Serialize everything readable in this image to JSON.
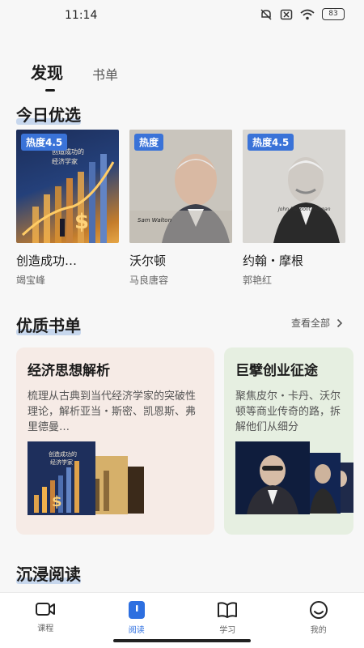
{
  "status": {
    "time": "11:14",
    "battery": "83"
  },
  "tabs": [
    {
      "label": "发现",
      "active": true
    },
    {
      "label": "书单",
      "active": false
    }
  ],
  "daily": {
    "title": "今日优选",
    "books": [
      {
        "badge": "热度4.5",
        "title": "创造成功…",
        "author": "竭宝峰"
      },
      {
        "badge": "热度",
        "title": "沃尔顿",
        "author": "马良唐容"
      },
      {
        "badge": "热度4.5",
        "title": "约翰・摩根",
        "author": "郭艳红"
      }
    ]
  },
  "quality": {
    "title": "优质书单",
    "see_all": "查看全部",
    "lists": [
      {
        "name": "经济思想解析",
        "desc": "梳理从古典到当代经济学家的突破性理论，解析亚当・斯密、凯恩斯、弗里德曼…"
      },
      {
        "name": "巨擘创业征途",
        "desc": "聚焦皮尔・卡丹、沃尔顿等商业传奇的路，拆解他们从细分"
      }
    ]
  },
  "immersive": {
    "title": "沉浸阅读"
  },
  "nav": [
    {
      "label": "课程",
      "icon": "video-icon",
      "active": false
    },
    {
      "label": "阅读",
      "icon": "book-active-icon",
      "active": true
    },
    {
      "label": "学习",
      "icon": "open-book-icon",
      "active": false
    },
    {
      "label": "我的",
      "icon": "smile-icon",
      "active": false
    }
  ],
  "colors": {
    "accent": "#2d6fe0",
    "badge": "#3a73d8"
  }
}
